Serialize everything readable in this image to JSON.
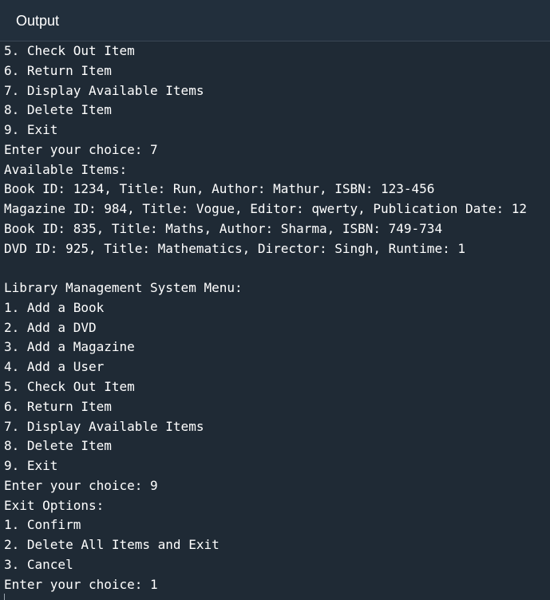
{
  "header": {
    "title": "Output"
  },
  "console": {
    "lines": [
      "5. Check Out Item",
      "6. Return Item",
      "7. Display Available Items",
      "8. Delete Item",
      "9. Exit",
      "Enter your choice: 7",
      "Available Items:",
      "Book ID: 1234, Title: Run, Author: Mathur, ISBN: 123-456",
      "Magazine ID: 984, Title: Vogue, Editor: qwerty, Publication Date: 12",
      "Book ID: 835, Title: Maths, Author: Sharma, ISBN: 749-734",
      "DVD ID: 925, Title: Mathematics, Director: Singh, Runtime: 1",
      "",
      "Library Management System Menu:",
      "1. Add a Book",
      "2. Add a DVD",
      "3. Add a Magazine",
      "4. Add a User",
      "5. Check Out Item",
      "6. Return Item",
      "7. Display Available Items",
      "8. Delete Item",
      "9. Exit",
      "Enter your choice: 9",
      "Exit Options:",
      "1. Confirm",
      "2. Delete All Items and Exit",
      "3. Cancel",
      "Enter your choice: 1"
    ]
  }
}
